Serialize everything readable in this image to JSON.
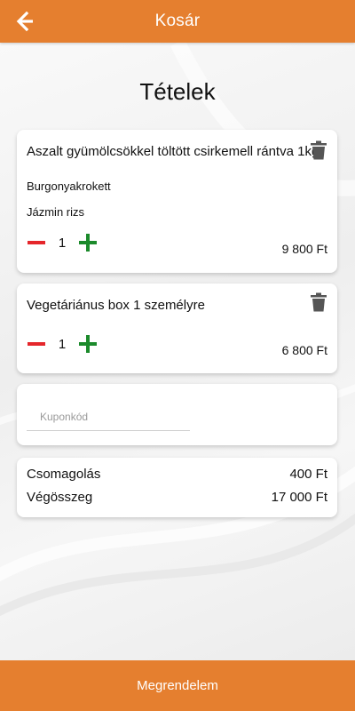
{
  "header": {
    "title": "Kosár",
    "back_icon": "arrow-left-icon"
  },
  "page": {
    "heading": "Tételek"
  },
  "cart": {
    "items": [
      {
        "name": "Aszalt gyümölcsökkel töltött csirkemell rántva 1kg",
        "sides": [
          "Burgonyakrokett",
          "Jázmin rizs"
        ],
        "quantity": "1",
        "price": "9 800 Ft"
      },
      {
        "name": "Vegetáriánus box 1 személyre",
        "sides": [],
        "quantity": "1",
        "price": "6 800 Ft"
      }
    ]
  },
  "coupon": {
    "placeholder": "Kuponkód",
    "value": ""
  },
  "summary": {
    "packaging_label": "Csomagolás",
    "packaging_value": "400 Ft",
    "total_label": "Végösszeg",
    "total_value": "17 000 Ft"
  },
  "footer": {
    "order_button": "Megrendelem"
  },
  "colors": {
    "accent": "#e57f2f",
    "minus": "#e5262b",
    "plus": "#1b8a2b",
    "trash": "#555555"
  }
}
